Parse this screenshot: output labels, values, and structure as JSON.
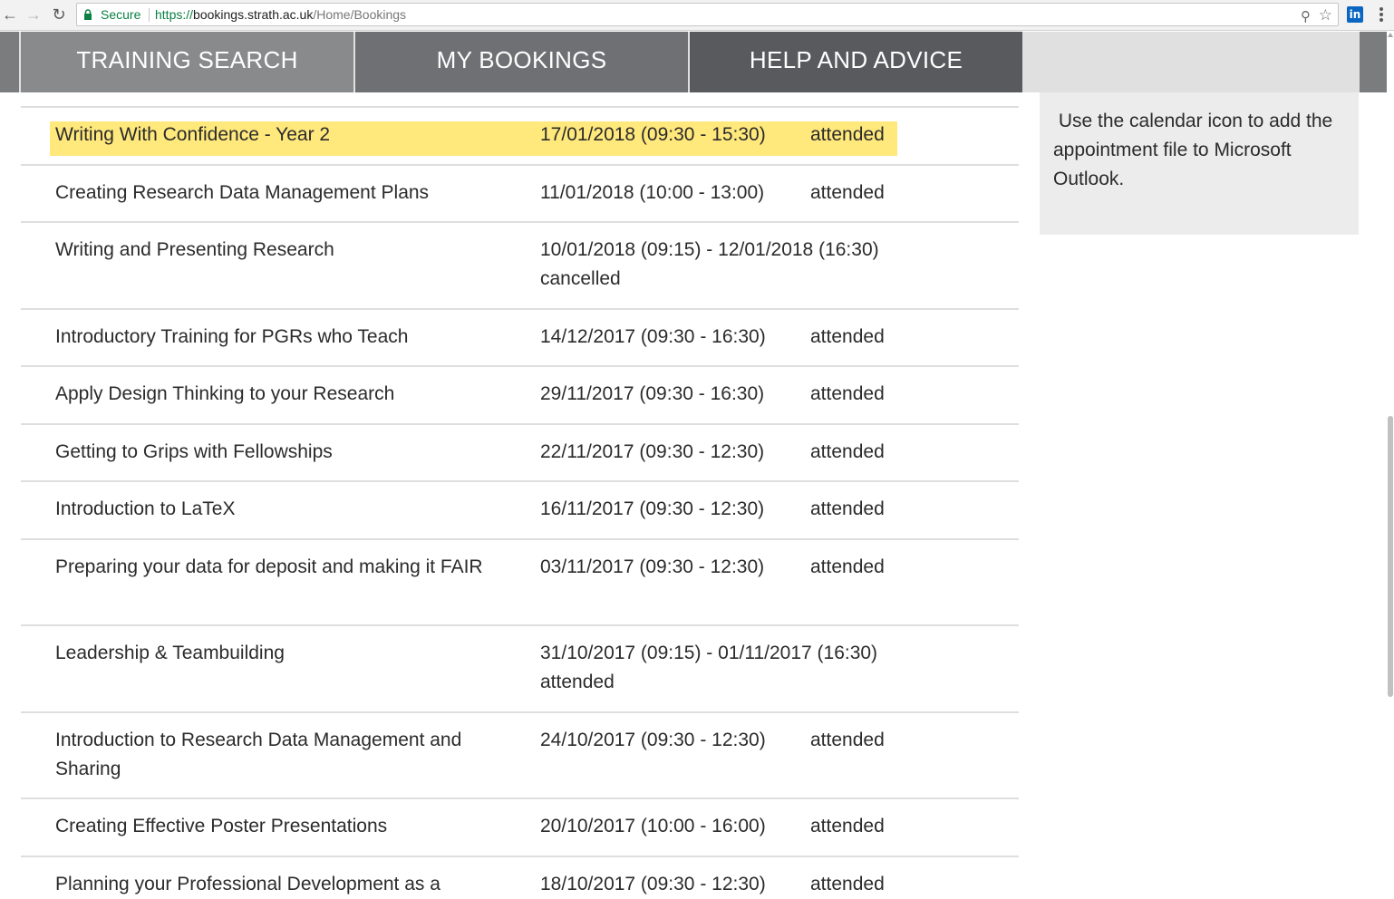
{
  "browser": {
    "secure_label": "Secure",
    "url_scheme": "https://",
    "url_host": "bookings.strath.ac.uk",
    "url_path": "/Home/Bookings",
    "linkedin_label": "in"
  },
  "nav": {
    "tabs": [
      {
        "label": "TRAINING SEARCH"
      },
      {
        "label": "MY BOOKINGS"
      },
      {
        "label": "HELP AND ADVICE"
      }
    ]
  },
  "sidebar": {
    "text": " Use the calendar icon to add the appointment file to Microsoft Outlook."
  },
  "bookings": [
    {
      "course": "Writing With Confidence - Year 2",
      "date": "17/01/2018 (09:30 - 15:30)",
      "status": "attended",
      "highlighted": true
    },
    {
      "course": "Creating Research Data Management Plans",
      "date": "11/01/2018 (10:00 - 13:00)",
      "status": "attended"
    },
    {
      "course": "Writing and Presenting Research",
      "date": "10/01/2018 (09:15) - 12/01/2018 (16:30)",
      "status": "cancelled"
    },
    {
      "course": "Introductory Training for PGRs who Teach",
      "date": "14/12/2017 (09:30 - 16:30)",
      "status": "attended"
    },
    {
      "course": "Apply Design Thinking to your Research",
      "date": "29/11/2017 (09:30 - 16:30)",
      "status": "attended"
    },
    {
      "course": "Getting to Grips with Fellowships",
      "date": "22/11/2017 (09:30 - 12:30)",
      "status": "attended"
    },
    {
      "course": "Introduction to LaTeX",
      "date": "16/11/2017 (09:30 - 12:30)",
      "status": "attended"
    },
    {
      "course": "Preparing your data for deposit and making it FAIR",
      "date": "03/11/2017 (09:30 - 12:30)",
      "status": "attended"
    },
    {
      "course": "Leadership & Teambuilding",
      "date": "31/10/2017 (09:15) - 01/11/2017 (16:30)",
      "status": "attended"
    },
    {
      "course": "Introduction to Research Data Management and Sharing",
      "date": "24/10/2017 (09:30 - 12:30)",
      "status": "attended"
    },
    {
      "course": "Creating Effective Poster Presentations",
      "date": "20/10/2017 (10:00 - 16:00)",
      "status": "attended"
    },
    {
      "course": "Planning your Professional Development as a",
      "date": "18/10/2017 (09:30 - 12:30)",
      "status": "attended"
    }
  ]
}
